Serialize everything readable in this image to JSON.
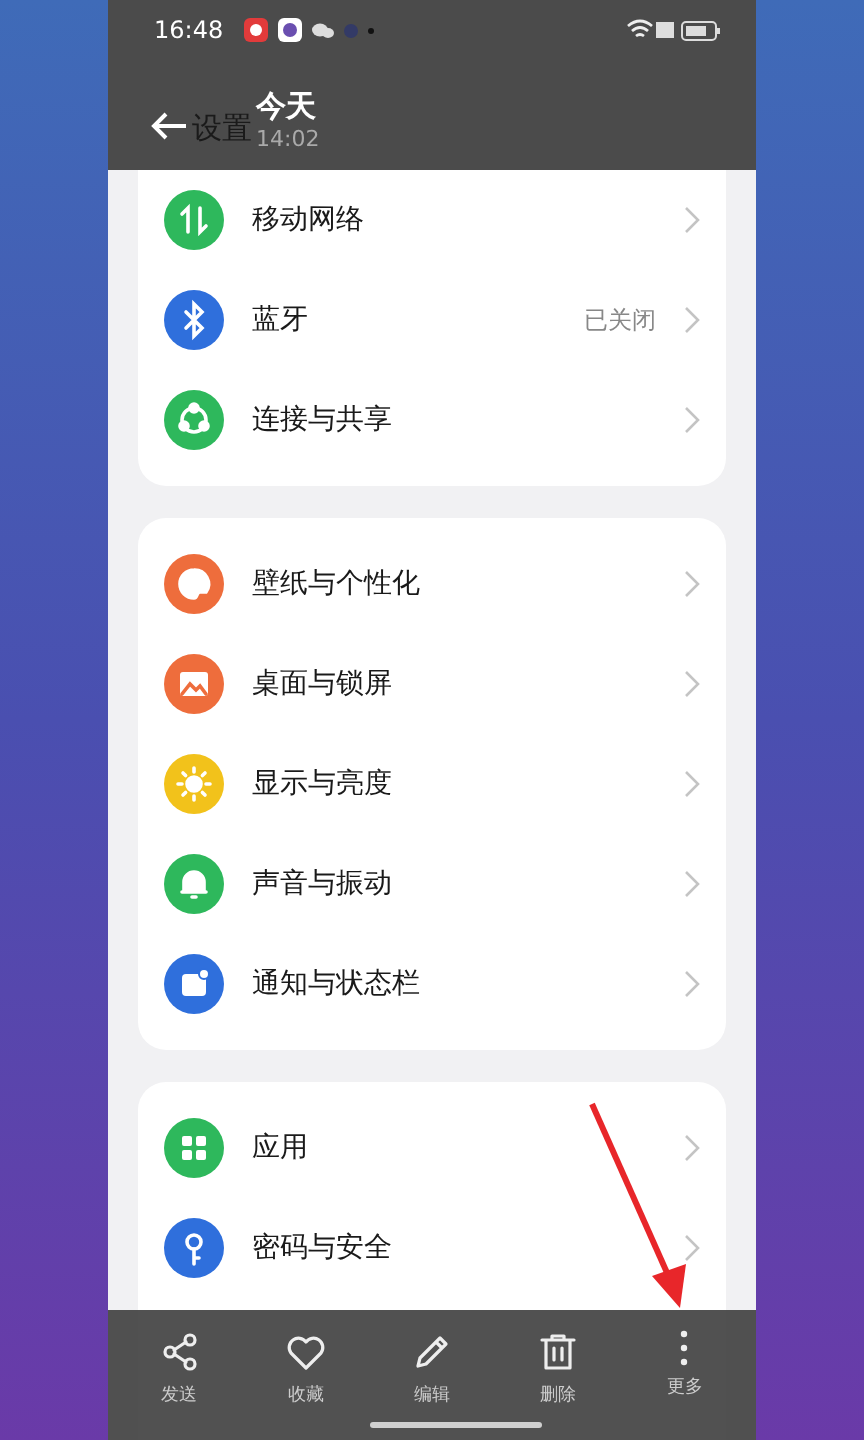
{
  "status_bar": {
    "time": "16:48"
  },
  "viewer": {
    "page_title": "设置",
    "title": "今天",
    "subtitle": "14:02"
  },
  "groups": [
    {
      "items": [
        {
          "label": "移动网络",
          "color": "#2eb85c"
        },
        {
          "label": "蓝牙",
          "color": "#2f6fdc",
          "value": "已关闭"
        },
        {
          "label": "连接与共享",
          "color": "#2eb85c"
        }
      ]
    },
    {
      "items": [
        {
          "label": "壁纸与个性化",
          "color": "#ee6d3c"
        },
        {
          "label": "桌面与锁屏",
          "color": "#ee6d3c"
        },
        {
          "label": "显示与亮度",
          "color": "#f2c21b"
        },
        {
          "label": "声音与振动",
          "color": "#2eb85c"
        },
        {
          "label": "通知与状态栏",
          "color": "#2f6fdc"
        }
      ]
    },
    {
      "items": [
        {
          "label": "应用",
          "color": "#2eb85c"
        },
        {
          "label": "密码与安全",
          "color": "#2f6fdc"
        }
      ]
    }
  ],
  "toolbar": [
    {
      "label": "发送"
    },
    {
      "label": "收藏"
    },
    {
      "label": "编辑"
    },
    {
      "label": "删除"
    },
    {
      "label": "更多"
    }
  ]
}
